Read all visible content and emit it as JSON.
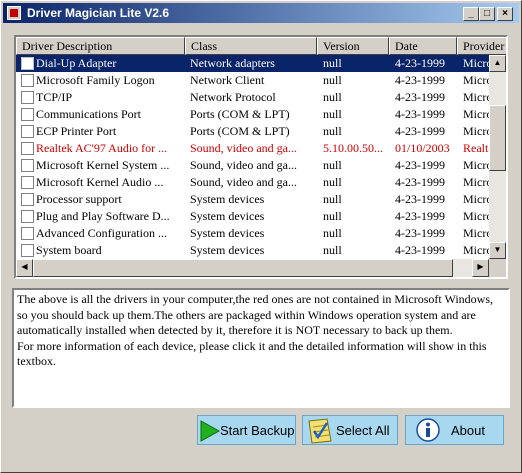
{
  "window": {
    "title": "Driver Magician Lite V2.6"
  },
  "titlebar_buttons": {
    "minimize": "_",
    "maximize": "□",
    "close": "×"
  },
  "columns": [
    "Driver Description",
    "Class",
    "Version",
    "Date",
    "Provider"
  ],
  "rows": [
    {
      "description": "Dial-Up Adapter",
      "class": "Network adapters",
      "version": "null",
      "date": "4-23-1999",
      "provider": "Microsoft",
      "selected": true
    },
    {
      "description": "Microsoft Family Logon",
      "class": "Network Client",
      "version": "null",
      "date": "4-23-1999",
      "provider": "Microsoft"
    },
    {
      "description": "TCP/IP",
      "class": "Network Protocol",
      "version": "null",
      "date": "4-23-1999",
      "provider": "Microsoft"
    },
    {
      "description": "Communications Port",
      "class": "Ports (COM & LPT)",
      "version": "null",
      "date": "4-23-1999",
      "provider": "Microsoft"
    },
    {
      "description": "ECP Printer Port",
      "class": "Ports (COM & LPT)",
      "version": "null",
      "date": "4-23-1999",
      "provider": "Microsoft"
    },
    {
      "description": "Realtek AC'97 Audio for ...",
      "class": "Sound, video and ga...",
      "version": "5.10.00.50...",
      "date": "01/10/2003",
      "provider": "Realtek",
      "red": true
    },
    {
      "description": "Microsoft Kernel System ...",
      "class": "Sound, video and ga...",
      "version": "null",
      "date": "4-23-1999",
      "provider": "Microsoft"
    },
    {
      "description": "Microsoft Kernel Audio ...",
      "class": "Sound, video and ga...",
      "version": "null",
      "date": "4-23-1999",
      "provider": "Microsoft"
    },
    {
      "description": "Processor support",
      "class": "System devices",
      "version": "null",
      "date": "4-23-1999",
      "provider": "Microsoft"
    },
    {
      "description": "Plug and Play Software D...",
      "class": "System devices",
      "version": "null",
      "date": "4-23-1999",
      "provider": "Microsoft"
    },
    {
      "description": "Advanced Configuration ...",
      "class": "System devices",
      "version": "null",
      "date": "4-23-1999",
      "provider": "Microsoft"
    },
    {
      "description": "System board",
      "class": "System devices",
      "version": "null",
      "date": "4-23-1999",
      "provider": "Microsoft"
    }
  ],
  "info": {
    "para1": "The above is all the drivers in your computer,the red ones are not contained in Microsoft Windows, so you should back up them.The others are packaged within Windows operation system and are automatically installed when detected by it, therefore it is NOT necessary to back up them.",
    "para2": "For more information of each device, please click it and the detailed information will show in this textbox."
  },
  "buttons": {
    "backup": "Start Backup",
    "select_all": "Select All",
    "about": "About"
  },
  "scroll_arrows": {
    "up": "▲",
    "down": "▼",
    "left": "◀",
    "right": "▶"
  },
  "colors": {
    "selection": "#0a246a",
    "not_in_windows": "#cc0000",
    "button_face": "#a8d8f0"
  },
  "icons": {
    "backup": "green-play-arrow-icon",
    "select_all": "checklist-icon",
    "about": "info-icon"
  }
}
